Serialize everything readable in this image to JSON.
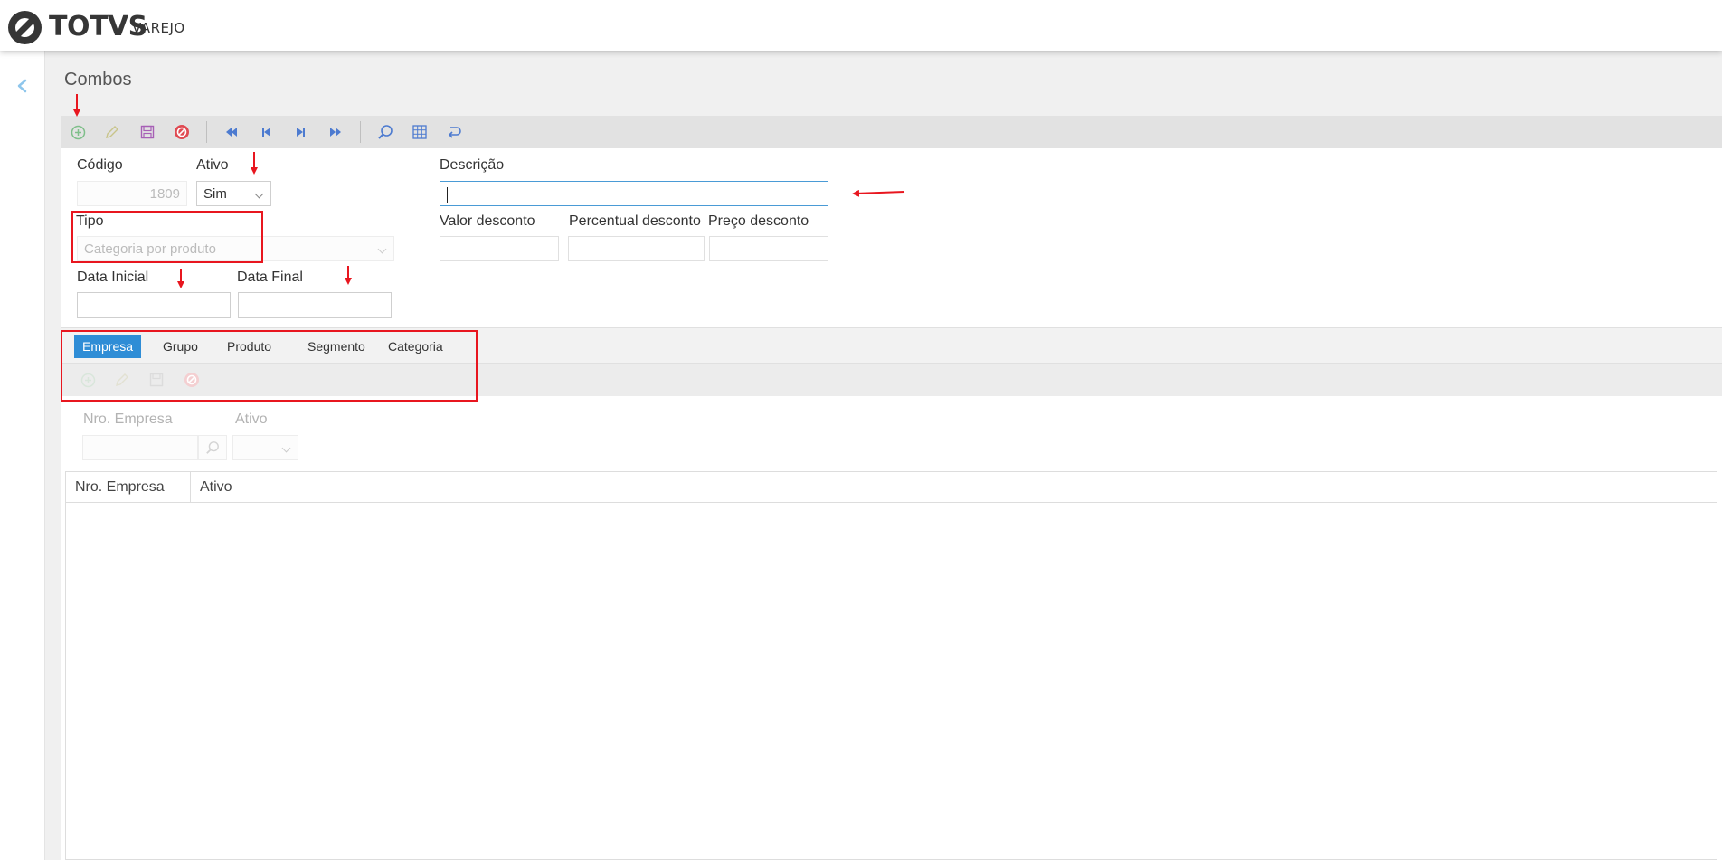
{
  "brand": {
    "name": "TOTVS",
    "sub": "VAREJO"
  },
  "page": {
    "title": "Combos"
  },
  "form": {
    "codigo_label": "Código",
    "codigo_value": "1809",
    "ativo_label": "Ativo",
    "ativo_value": "Sim",
    "descricao_label": "Descrição",
    "descricao_value": "",
    "tipo_label": "Tipo",
    "tipo_placeholder": "Categoria por produto",
    "valor_desconto_label": "Valor desconto",
    "percentual_desconto_label": "Percentual desconto",
    "preco_desconto_label": "Preço desconto",
    "data_inicial_label": "Data Inicial",
    "data_final_label": "Data Final"
  },
  "tabs": [
    {
      "label": "Empresa",
      "active": true
    },
    {
      "label": "Grupo",
      "active": false
    },
    {
      "label": "Produto",
      "active": false
    },
    {
      "label": "Segmento",
      "active": false
    },
    {
      "label": "Categoria",
      "active": false
    }
  ],
  "subform": {
    "nro_empresa_label": "Nro. Empresa",
    "ativo_label": "Ativo"
  },
  "grid": {
    "columns": [
      "Nro. Empresa",
      "Ativo"
    ],
    "rows": []
  },
  "colors": {
    "accent": "#2f8dd6",
    "annotation": "#e8161f",
    "toolbar_bg": "#e2e2e2"
  },
  "icons": {
    "toolbar": [
      "add-icon",
      "edit-icon",
      "save-icon",
      "cancel-icon",
      "first-record-icon",
      "previous-record-icon",
      "next-record-icon",
      "last-record-icon",
      "search-icon",
      "grid-icon",
      "undo-icon"
    ],
    "subtoolbar": [
      "add-icon",
      "edit-icon",
      "save-icon",
      "cancel-icon"
    ]
  }
}
